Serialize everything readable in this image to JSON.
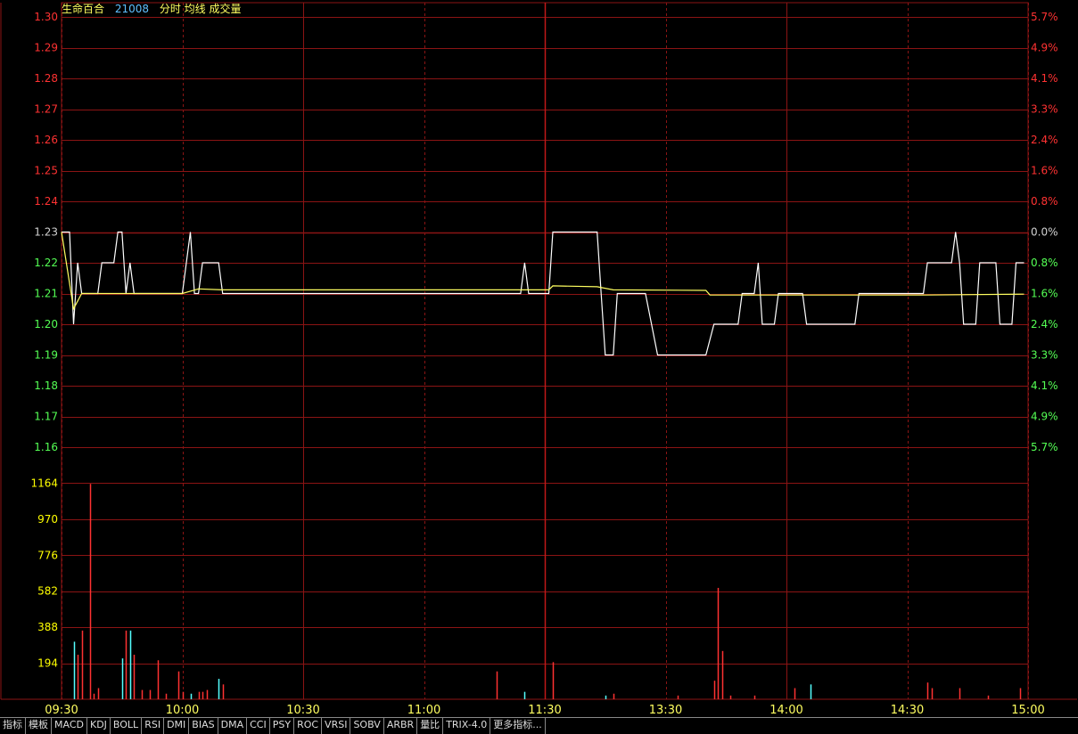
{
  "header": {
    "name": "生命百合",
    "code": "21008",
    "indicators": "分时 均线 成交量"
  },
  "colors": {
    "grid": "#8b1414",
    "up": "#ff3232",
    "down": "#54ff54",
    "price_line": "#ffffff",
    "avg_line": "#ffff60",
    "vol_axis": "#ffff00",
    "name_color": "#ffff60",
    "code_color": "#60c0ff"
  },
  "tabs": [
    "指标",
    "模板",
    "MACD",
    "KDJ",
    "BOLL",
    "RSI",
    "DMI",
    "BIAS",
    "DMA",
    "CCI",
    "PSY",
    "ROC",
    "VRSI",
    "SOBV",
    "ARBR",
    "量比",
    "TRIX-4.0",
    "更多指标..."
  ],
  "chart_data": {
    "type": "line",
    "x_ticks": [
      "09:30",
      "10:00",
      "10:30",
      "11:00",
      "11:30",
      "13:30",
      "14:00",
      "14:30",
      "15:00"
    ],
    "price_axis": {
      "labels": [
        "1.30",
        "1.29",
        "1.28",
        "1.27",
        "1.26",
        "1.25",
        "1.24",
        "1.23",
        "1.22",
        "1.21",
        "1.20",
        "1.19",
        "1.18",
        "1.17",
        "1.16"
      ],
      "values": [
        1.3,
        1.29,
        1.28,
        1.27,
        1.26,
        1.25,
        1.24,
        1.23,
        1.22,
        1.21,
        1.2,
        1.19,
        1.18,
        1.17,
        1.16
      ],
      "ylim": [
        1.16,
        1.3
      ],
      "prev_close": 1.23
    },
    "pct_axis": [
      "5.7%",
      "4.9%",
      "4.1%",
      "3.3%",
      "2.4%",
      "1.6%",
      "0.8%",
      "0.0%",
      "0.8%",
      "1.6%",
      "2.4%",
      "3.3%",
      "4.1%",
      "4.9%",
      "5.7%"
    ],
    "volume_axis": {
      "labels": [
        "1164",
        "970",
        "776",
        "582",
        "388",
        "194"
      ],
      "values": [
        1164,
        970,
        776,
        582,
        388,
        194
      ],
      "ylim": [
        0,
        1358
      ]
    },
    "series": [
      {
        "key": "price",
        "points": [
          [
            0,
            1.23
          ],
          [
            2,
            1.23
          ],
          [
            3,
            1.2
          ],
          [
            4,
            1.22
          ],
          [
            5,
            1.21
          ],
          [
            9,
            1.21
          ],
          [
            10,
            1.22
          ],
          [
            13,
            1.22
          ],
          [
            14,
            1.23
          ],
          [
            15,
            1.23
          ],
          [
            16,
            1.21
          ],
          [
            17,
            1.22
          ],
          [
            18,
            1.21
          ],
          [
            30,
            1.21
          ],
          [
            31,
            1.22
          ],
          [
            32,
            1.23
          ],
          [
            33,
            1.21
          ],
          [
            34,
            1.21
          ],
          [
            35,
            1.22
          ],
          [
            39,
            1.22
          ],
          [
            40,
            1.21
          ],
          [
            114,
            1.21
          ],
          [
            115,
            1.22
          ],
          [
            116,
            1.21
          ],
          [
            121,
            1.21
          ],
          [
            122,
            1.23
          ],
          [
            133,
            1.23
          ],
          [
            134,
            1.21
          ],
          [
            135,
            1.19
          ],
          [
            137,
            1.19
          ],
          [
            138,
            1.21
          ],
          [
            145,
            1.21
          ],
          [
            148,
            1.19
          ],
          [
            160,
            1.19
          ],
          [
            162,
            1.2
          ],
          [
            168,
            1.2
          ],
          [
            169,
            1.21
          ],
          [
            172,
            1.21
          ],
          [
            173,
            1.22
          ],
          [
            174,
            1.2
          ],
          [
            177,
            1.2
          ],
          [
            178,
            1.21
          ],
          [
            184,
            1.21
          ],
          [
            185,
            1.2
          ],
          [
            197,
            1.2
          ],
          [
            198,
            1.21
          ],
          [
            214,
            1.21
          ],
          [
            215,
            1.22
          ],
          [
            221,
            1.22
          ],
          [
            222,
            1.23
          ],
          [
            223,
            1.22
          ],
          [
            224,
            1.2
          ],
          [
            227,
            1.2
          ],
          [
            228,
            1.22
          ],
          [
            232,
            1.22
          ],
          [
            233,
            1.2
          ],
          [
            236,
            1.2
          ],
          [
            237,
            1.22
          ],
          [
            239,
            1.22
          ]
        ]
      },
      {
        "key": "avg",
        "points": [
          [
            0,
            1.23
          ],
          [
            3,
            1.205
          ],
          [
            5,
            1.21
          ],
          [
            9,
            1.21
          ],
          [
            18,
            1.21
          ],
          [
            30,
            1.21
          ],
          [
            34,
            1.2115
          ],
          [
            40,
            1.2112
          ],
          [
            100,
            1.2112
          ],
          [
            121,
            1.2112
          ],
          [
            122,
            1.2125
          ],
          [
            133,
            1.2122
          ],
          [
            137,
            1.2112
          ],
          [
            160,
            1.211
          ],
          [
            161,
            1.2095
          ],
          [
            180,
            1.2095
          ],
          [
            214,
            1.2095
          ],
          [
            239,
            1.2098
          ]
        ]
      }
    ],
    "volume": [
      {
        "t": 3,
        "v": 310,
        "dir": "down"
      },
      {
        "t": 4,
        "v": 240,
        "dir": "up"
      },
      {
        "t": 5,
        "v": 370,
        "dir": "up"
      },
      {
        "t": 7,
        "v": 1160,
        "dir": "up"
      },
      {
        "t": 8,
        "v": 30,
        "dir": "up"
      },
      {
        "t": 9,
        "v": 60,
        "dir": "up"
      },
      {
        "t": 15,
        "v": 220,
        "dir": "down"
      },
      {
        "t": 16,
        "v": 370,
        "dir": "up"
      },
      {
        "t": 17,
        "v": 370,
        "dir": "down"
      },
      {
        "t": 18,
        "v": 240,
        "dir": "up"
      },
      {
        "t": 20,
        "v": 50,
        "dir": "up"
      },
      {
        "t": 22,
        "v": 50,
        "dir": "up"
      },
      {
        "t": 24,
        "v": 210,
        "dir": "up"
      },
      {
        "t": 26,
        "v": 30,
        "dir": "up"
      },
      {
        "t": 29,
        "v": 150,
        "dir": "up"
      },
      {
        "t": 30,
        "v": 40,
        "dir": "up"
      },
      {
        "t": 32,
        "v": 30,
        "dir": "down"
      },
      {
        "t": 34,
        "v": 40,
        "dir": "up"
      },
      {
        "t": 35,
        "v": 40,
        "dir": "up"
      },
      {
        "t": 36,
        "v": 50,
        "dir": "up"
      },
      {
        "t": 39,
        "v": 110,
        "dir": "down"
      },
      {
        "t": 40,
        "v": 80,
        "dir": "up"
      },
      {
        "t": 108,
        "v": 150,
        "dir": "up"
      },
      {
        "t": 115,
        "v": 40,
        "dir": "down"
      },
      {
        "t": 122,
        "v": 200,
        "dir": "up"
      },
      {
        "t": 135,
        "v": 20,
        "dir": "down"
      },
      {
        "t": 137,
        "v": 30,
        "dir": "up"
      },
      {
        "t": 153,
        "v": 20,
        "dir": "up"
      },
      {
        "t": 162,
        "v": 100,
        "dir": "up"
      },
      {
        "t": 163,
        "v": 600,
        "dir": "up"
      },
      {
        "t": 164,
        "v": 260,
        "dir": "up"
      },
      {
        "t": 166,
        "v": 20,
        "dir": "up"
      },
      {
        "t": 172,
        "v": 20,
        "dir": "up"
      },
      {
        "t": 182,
        "v": 60,
        "dir": "up"
      },
      {
        "t": 186,
        "v": 80,
        "dir": "down"
      },
      {
        "t": 215,
        "v": 90,
        "dir": "up"
      },
      {
        "t": 216,
        "v": 60,
        "dir": "up"
      },
      {
        "t": 223,
        "v": 60,
        "dir": "up"
      },
      {
        "t": 230,
        "v": 20,
        "dir": "up"
      },
      {
        "t": 238,
        "v": 60,
        "dir": "up"
      }
    ]
  }
}
